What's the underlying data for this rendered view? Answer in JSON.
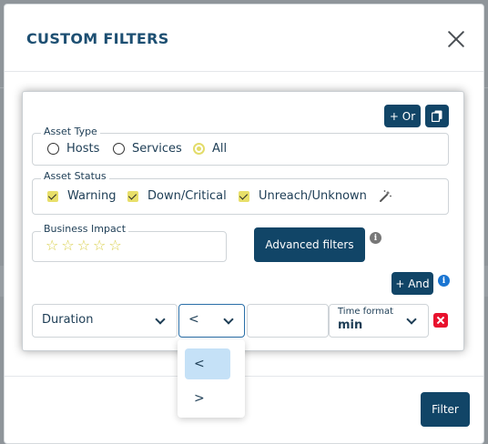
{
  "modal": {
    "title": "CUSTOM FILTERS",
    "filter_button": "Filter"
  },
  "toolbar": {
    "or_button": "+ Or",
    "copy_icon": "copy-icon"
  },
  "asset_type": {
    "legend": "Asset Type",
    "options": [
      {
        "label": "Hosts",
        "selected": false
      },
      {
        "label": "Services",
        "selected": false
      },
      {
        "label": "All",
        "selected": true
      }
    ]
  },
  "asset_status": {
    "legend": "Asset Status",
    "options": [
      {
        "label": "Warning",
        "checked": true
      },
      {
        "label": "Down/Critical",
        "checked": true
      },
      {
        "label": "Unreach/Unknown",
        "checked": true
      }
    ],
    "magic_icon": "magic-wand-icon"
  },
  "business_impact": {
    "legend": "Business Impact",
    "stars": "☆☆☆☆☆",
    "rating": 0,
    "max_rating": 5
  },
  "advanced_filters_button": "Advanced filters",
  "and_button": "+ And",
  "condition": {
    "field": "Duration",
    "operator": "<",
    "value": "",
    "time_format_label": "Time format",
    "time_format_value": "min"
  },
  "operator_dropdown": {
    "options": [
      "<",
      ">"
    ],
    "selected": "<"
  },
  "colors": {
    "accent_dark": "#114567",
    "title": "#1d4f72",
    "check": "#e8df6a",
    "delete": "#e8112d",
    "info": "#1a75d2",
    "info_gray": "#777777"
  }
}
